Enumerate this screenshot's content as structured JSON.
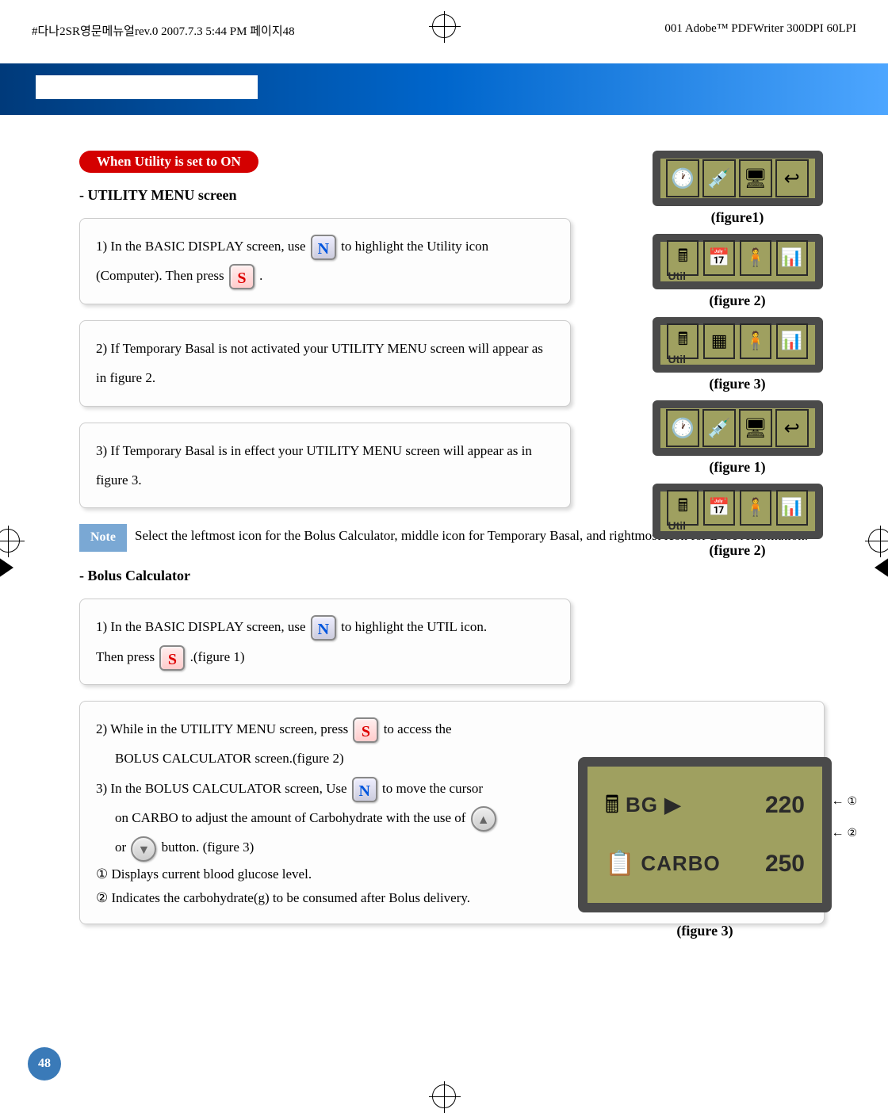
{
  "header": {
    "left": "#다나2SR영문메뉴얼rev.0  2007.7.3 5:44 PM  페이지48",
    "right": "001 Adobe™ PDFWriter 300DPI 60LPI"
  },
  "pill": "When Utility is set to ON",
  "section1_title": "- UTILITY MENU screen",
  "step1_a": "1) In the BASIC DISPLAY screen, use ",
  "step1_b": " to highlight the Utility icon",
  "step1_c": "(Computer). Then press ",
  "step1_d": " .",
  "step2": "2) If Temporary Basal is not activated your UTILITY MENU screen will appear as in figure 2.",
  "step3": "3) If Temporary Basal is in effect your UTILITY MENU screen will appear as in figure 3.",
  "note_label": "Note",
  "note_text": "Select the leftmost icon for the Bolus Calculator, middle icon for Temporary Basal, and rightmost icon for Dose Automation.",
  "section2_title": "- Bolus Calculator",
  "bc_step1_a": "1) In the BASIC DISPLAY screen, use ",
  "bc_step1_b": " to highlight the UTIL icon.",
  "bc_step1_c": "Then press ",
  "bc_step1_d": " .(figure 1)",
  "bc_step2_a": "2) While in the UTILITY MENU screen, press ",
  "bc_step2_b": " to access the",
  "bc_step2_c": "BOLUS CALCULATOR screen.(figure 2)",
  "bc_step3_a": "3) In the BOLUS CALCULATOR screen, Use ",
  "bc_step3_b": " to move the cursor",
  "bc_step3_c": "on CARBO to adjust the amount of Carbohydrate with the use of ",
  "bc_step3_d": "or ",
  "bc_step3_e": " button. (figure 3)",
  "footnote1": "① Displays current blood glucose level.",
  "footnote2": "② Indicates the carbohydrate(g) to be consumed after Bolus delivery.",
  "fig1_label": "(figure1)",
  "fig2_label": "(figure 2)",
  "fig3_label": "(figure 3)",
  "fig1b_label": "(figure 1)",
  "fig2b_label": "(figure 2)",
  "fig3b_label": "(figure 3)",
  "util_text": "Util",
  "calc": {
    "bg_label": "BG ▶",
    "bg_val": "220",
    "carbo_label": "CARBO",
    "carbo_val": "250"
  },
  "anno1": "①",
  "anno2": "②",
  "page": "48",
  "btn_n": "N",
  "btn_s": "S",
  "btn_up": "▲",
  "btn_down": "▼"
}
